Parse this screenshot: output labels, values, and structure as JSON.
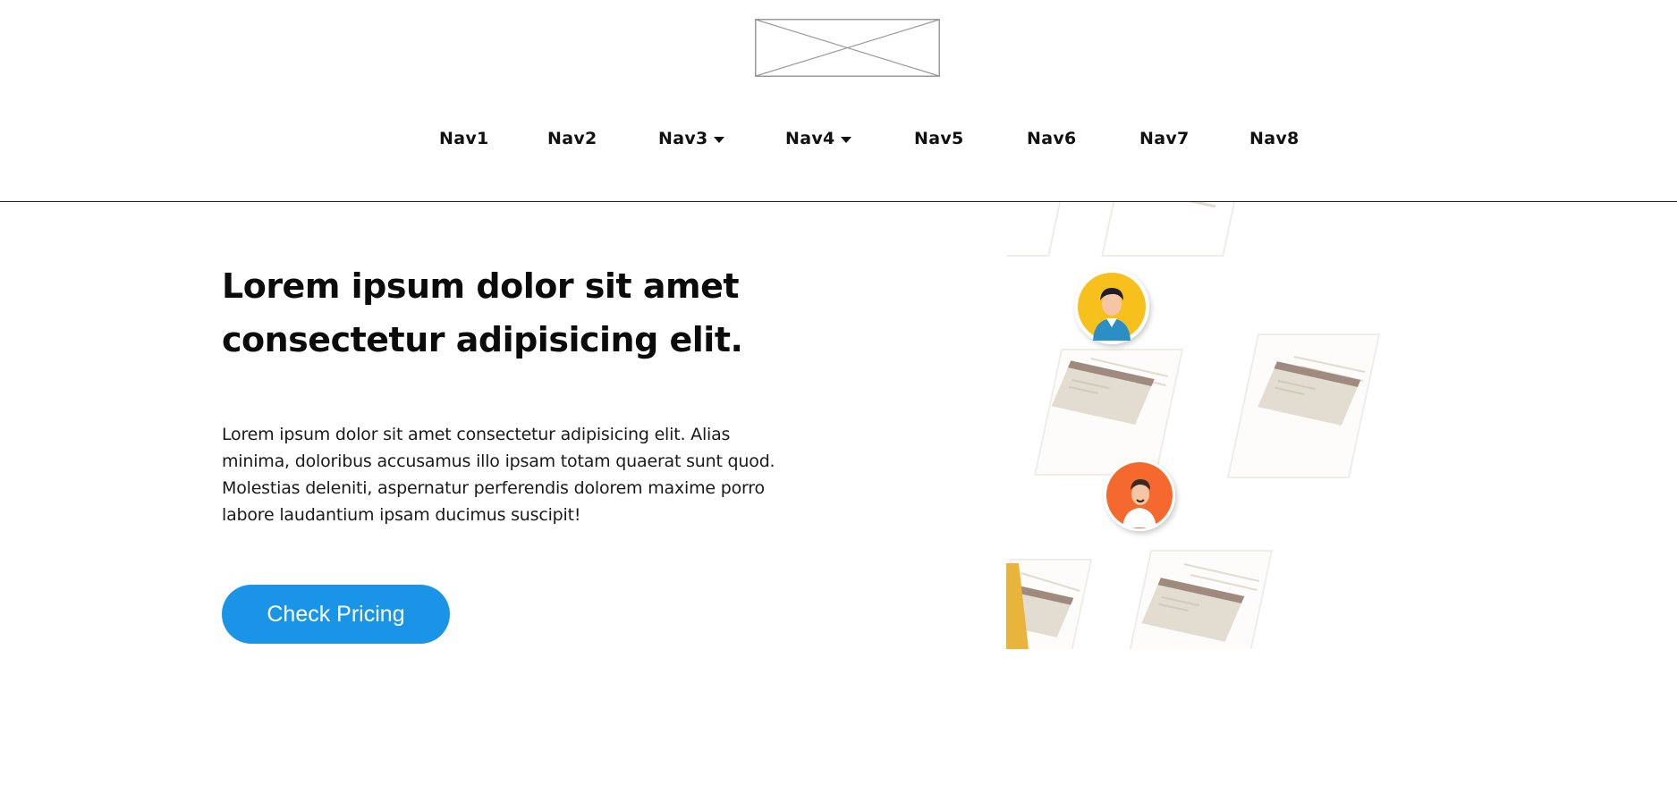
{
  "header": {
    "logo_icon": "logo-placeholder-icon",
    "nav": [
      {
        "label": "Nav1",
        "has_dropdown": false
      },
      {
        "label": "Nav2",
        "has_dropdown": false
      },
      {
        "label": "Nav3",
        "has_dropdown": true
      },
      {
        "label": "Nav4",
        "has_dropdown": true
      },
      {
        "label": "Nav5",
        "has_dropdown": false
      },
      {
        "label": "Nav6",
        "has_dropdown": false
      },
      {
        "label": "Nav7",
        "has_dropdown": false
      },
      {
        "label": "Nav8",
        "has_dropdown": false
      }
    ]
  },
  "hero": {
    "title": "Lorem ipsum dolor sit amet consectetur adipisicing elit.",
    "text": "Lorem ipsum dolor sit amet consectetur adipisicing elit. Alias minima, doloribus accusamus illo ipsam totam quaerat sunt quod. Molestias deleniti, aspernatur perferendis dolorem maxime porro labore laudantium ipsam ducimus suscipit!",
    "cta_label": "Check Pricing",
    "illustration_icon": "document-cards-avatars-illustration"
  },
  "colors": {
    "accent": "#1a94e6",
    "avatar_yellow": "#f7c01c",
    "avatar_orange": "#f5692e",
    "card_panel": "#e2ddd0",
    "card_stripe": "#a08a80",
    "yellow_shape": "#e9b43c"
  }
}
